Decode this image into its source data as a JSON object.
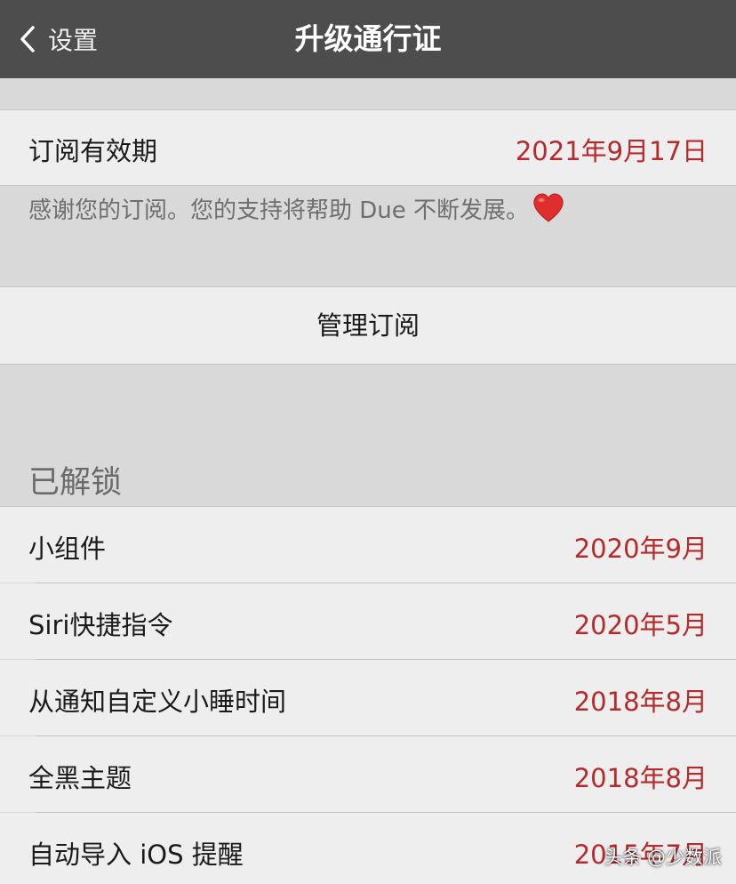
{
  "nav": {
    "back_label": "设置",
    "title": "升级通行证"
  },
  "subscription": {
    "label": "订阅有效期",
    "value": "2021年9月17日",
    "note": "感谢您的订阅。您的支持将帮助 Due 不断发展。",
    "manage_label": "管理订阅"
  },
  "unlocked": {
    "header": "已解锁",
    "items": [
      {
        "label": "小组件",
        "date": "2020年9月"
      },
      {
        "label": "Siri快捷指令",
        "date": "2020年5月"
      },
      {
        "label": "从通知自定义小睡时间",
        "date": "2018年8月"
      },
      {
        "label": "全黑主题",
        "date": "2018年8月"
      },
      {
        "label": "自动导入 iOS 提醒",
        "date": "2015年7月"
      }
    ]
  },
  "watermark": "头条 @少数派",
  "colors": {
    "navbar": "#4d4d4d",
    "accent_red": "#b52a2a",
    "row_bg": "#eeeeee",
    "page_bg": "#d9d9d9"
  },
  "icons": {
    "back": "chevron-left-icon",
    "heart": "red-heart-icon"
  }
}
